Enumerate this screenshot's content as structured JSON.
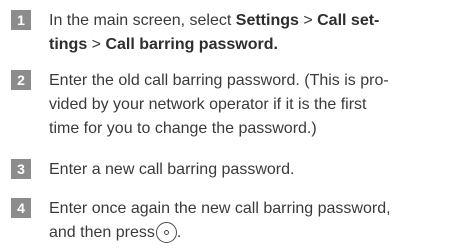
{
  "steps": [
    {
      "number": "1",
      "parts": [
        "In the main screen, select ",
        "Settings",
        " > ",
        "Call set-",
        "tings",
        " > ",
        "Call barring password."
      ]
    },
    {
      "number": "2",
      "lines": [
        "Enter the old call barring password. (This is pro-",
        "vided by your network operator if it is the first",
        "time for you to change the password.)"
      ]
    },
    {
      "number": "3",
      "lines": [
        "Enter a new call barring password."
      ]
    },
    {
      "number": "4",
      "lines": [
        "Enter once again the new call barring password,",
        "and then press"
      ],
      "end": "."
    }
  ],
  "icons": {
    "ok_key": "ok-key-icon"
  }
}
